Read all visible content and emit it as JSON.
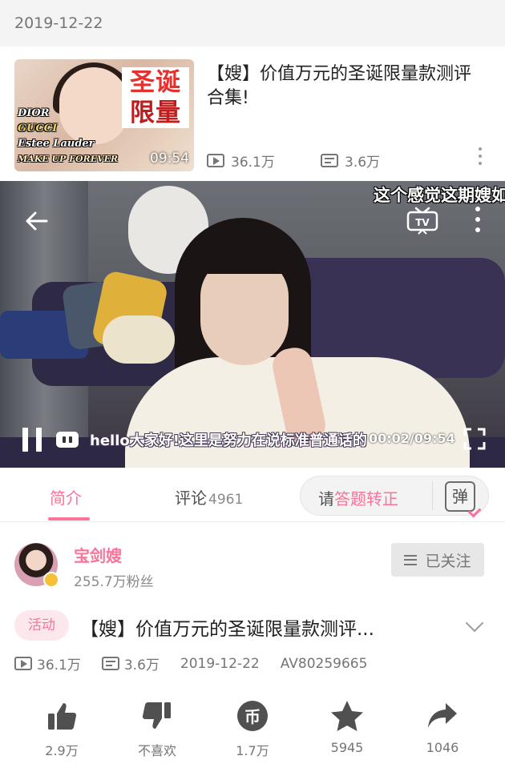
{
  "date_header": "2019-12-22",
  "related_video": {
    "title": "【嫂】价值万元的圣诞限量款测评合集!",
    "duration": "09:54",
    "views": "36.1万",
    "danmaku": "3.6万",
    "thumbnail_brands": [
      "DIOR",
      "GUCCI",
      "Estee Lauder",
      "MAKE UP FOREVER"
    ],
    "thumbnail_tag": [
      "圣诞",
      "限量"
    ]
  },
  "player": {
    "danmaku_top": "这个感觉这期嫂如",
    "danmaku_bottom": "hello大家好!这里是努力在说标准普通话的",
    "current_time": "00:02",
    "total_time": "09:54"
  },
  "tabs": {
    "intro": "简介",
    "comments": "评论",
    "comments_count": "4961"
  },
  "answer_button": {
    "prefix": "请",
    "highlight": "答题转正",
    "icon_char": "弹"
  },
  "uploader": {
    "name": "宝剑嫂",
    "fans": "255.7万粉丝",
    "follow_label": "已关注"
  },
  "video": {
    "tag": "活动",
    "title": "【嫂】价值万元的圣诞限量款测评...",
    "views": "36.1万",
    "danmaku": "3.6万",
    "date": "2019-12-22",
    "av_id": "AV80259665"
  },
  "actions": {
    "like": "2.9万",
    "dislike": "不喜欢",
    "coin": "1.7万",
    "favorite": "5945",
    "share": "1046"
  },
  "colors": {
    "accent": "#fb7299",
    "text": "#212121",
    "muted": "#757575"
  }
}
